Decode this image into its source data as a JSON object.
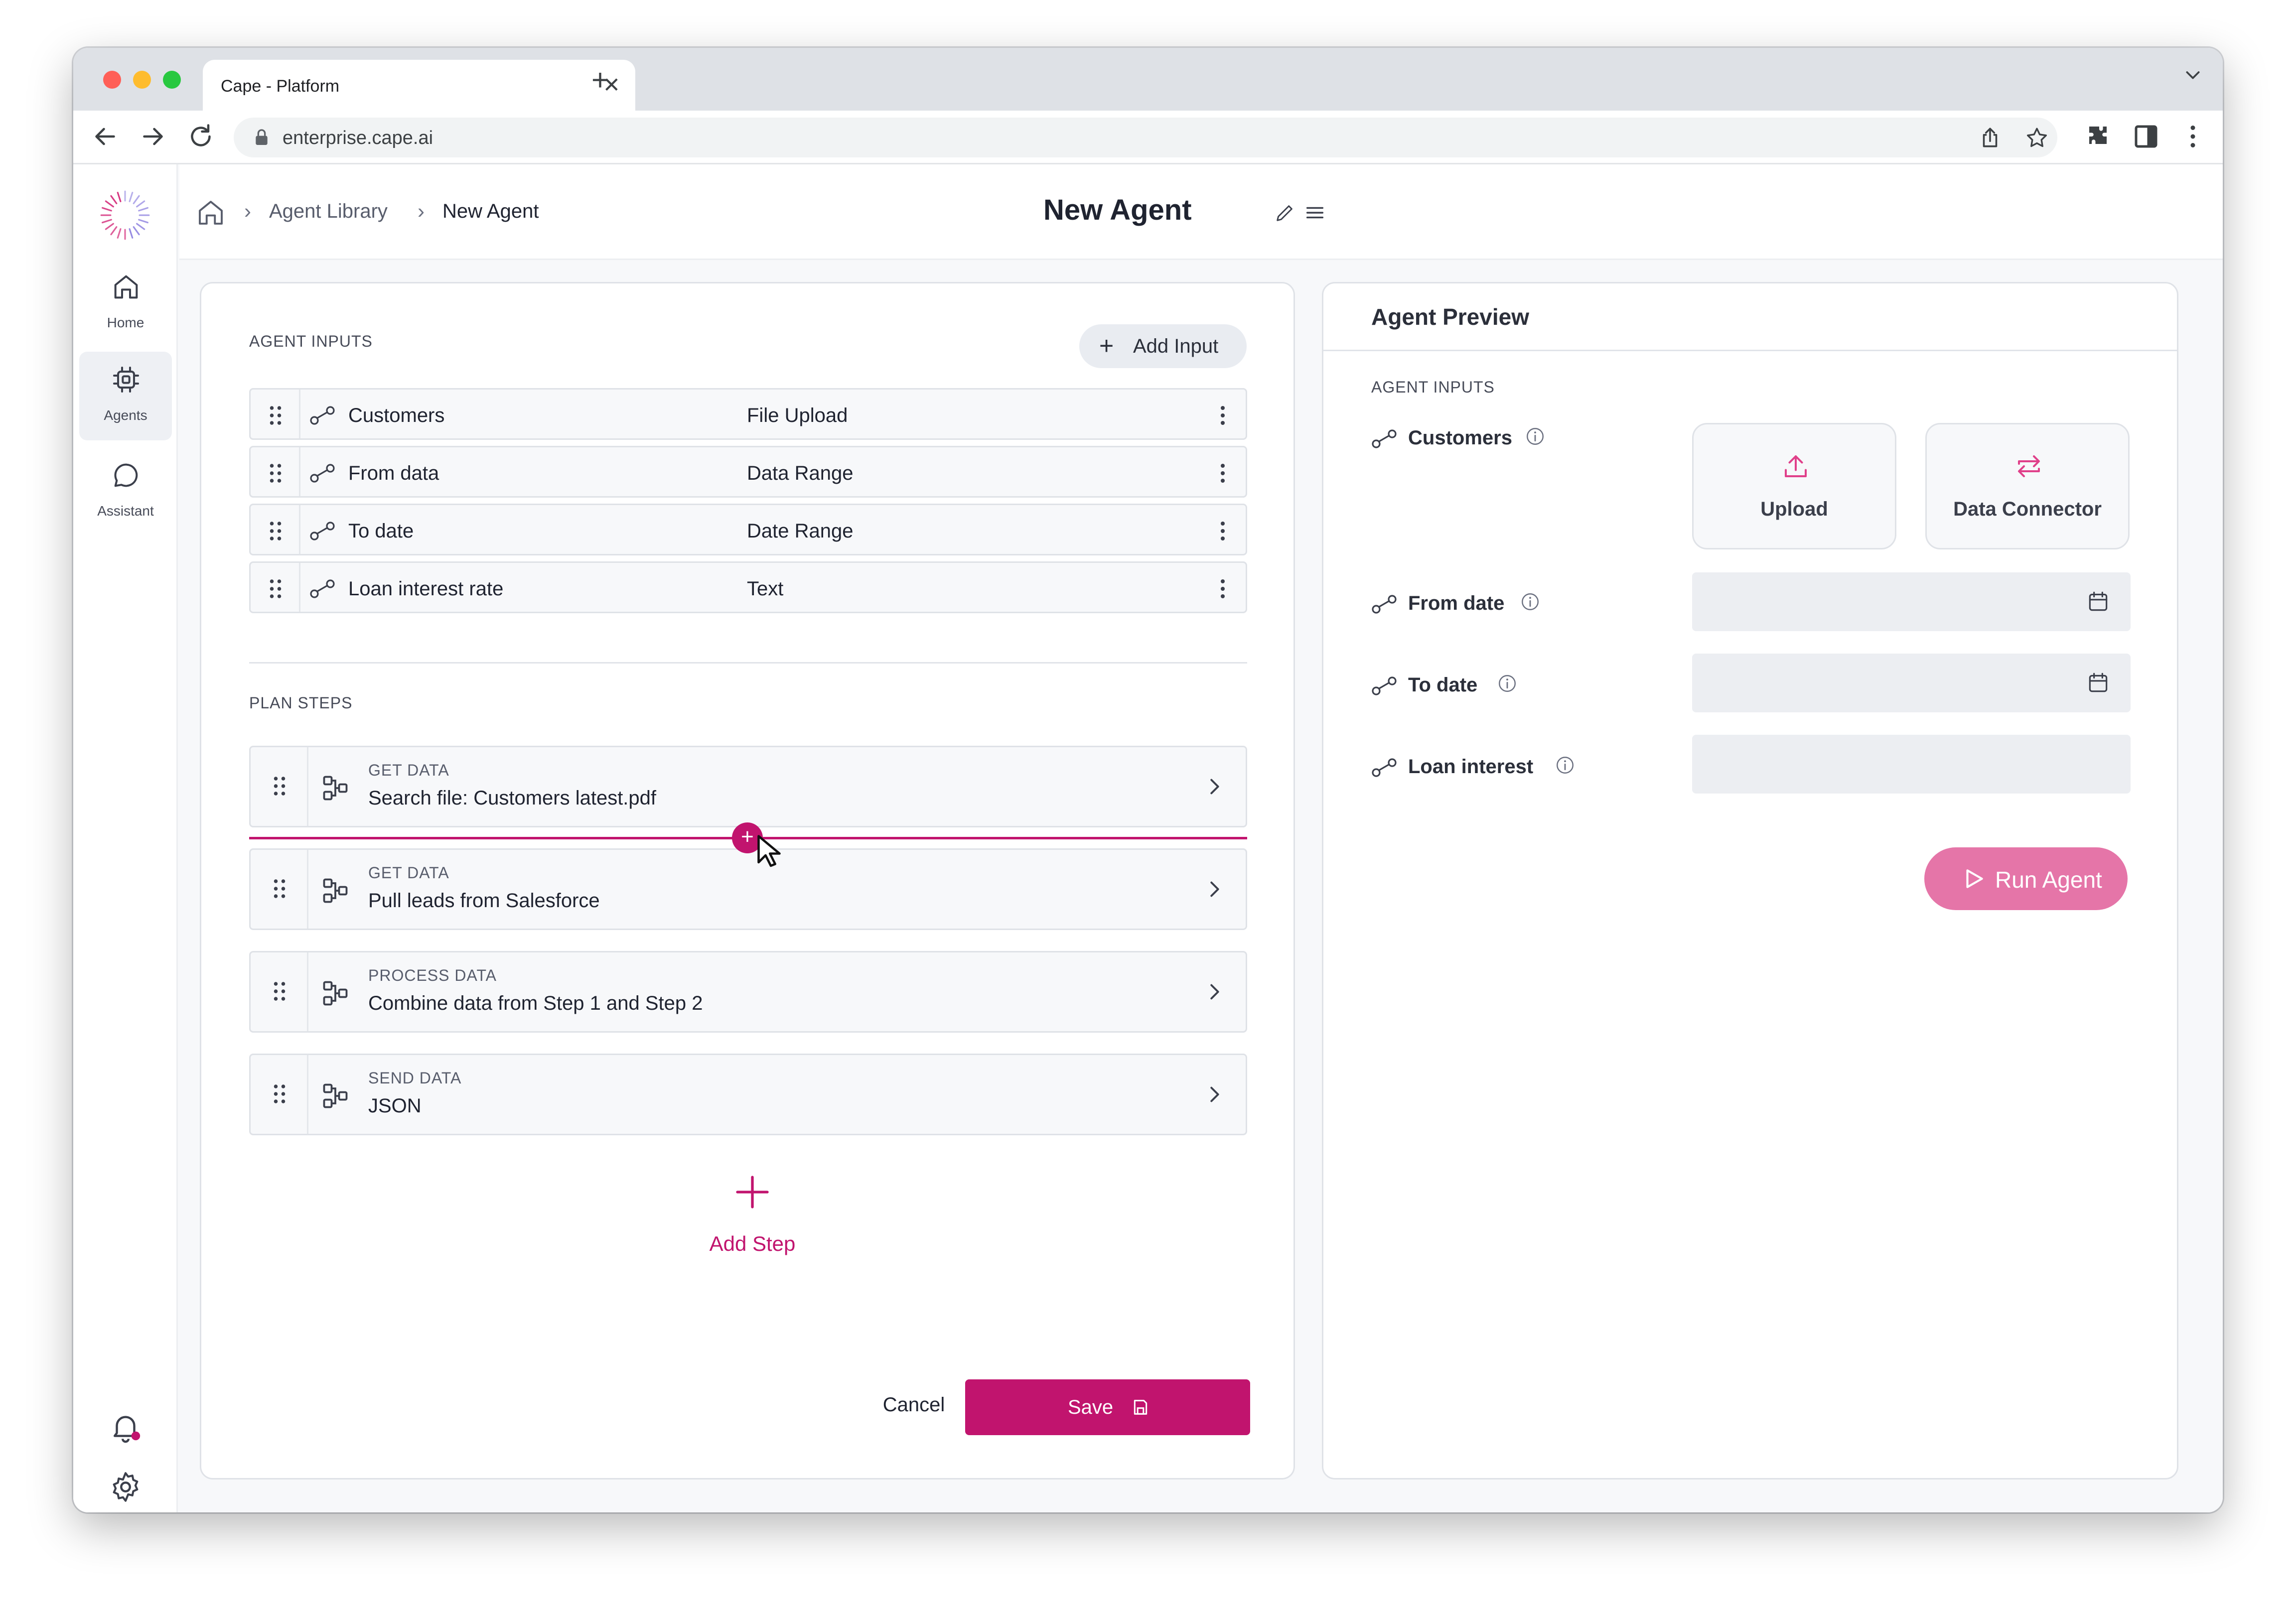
{
  "browser": {
    "tab_title": "Cape - Platform",
    "url": "enterprise.cape.ai"
  },
  "sidebar": {
    "items": [
      {
        "label": "Home",
        "icon": "home-icon"
      },
      {
        "label": "Agents",
        "icon": "agent-chip-icon",
        "active": true
      },
      {
        "label": "Assistant",
        "icon": "chat-bubble-icon"
      }
    ],
    "bottom_icons": [
      "bell-icon",
      "gear-icon"
    ]
  },
  "breadcrumb": {
    "items": [
      "Agent Library",
      "New Agent"
    ]
  },
  "page": {
    "title": "New Agent"
  },
  "editor": {
    "inputs_label": "AGENT INPUTS",
    "add_input_label": "Add Input",
    "inputs": [
      {
        "name": "Customers",
        "type": "File Upload"
      },
      {
        "name": "From data",
        "type": "Data Range"
      },
      {
        "name": "To date",
        "type": "Date Range"
      },
      {
        "name": "Loan interest rate",
        "type": "Text"
      }
    ],
    "steps_label": "PLAN STEPS",
    "steps": [
      {
        "kind": "GET DATA",
        "desc": "Search file: Customers latest.pdf"
      },
      {
        "kind": "GET DATA",
        "desc": "Pull leads from Salesforce"
      },
      {
        "kind": "PROCESS DATA",
        "desc": "Combine data from Step 1 and Step 2"
      },
      {
        "kind": "SEND DATA",
        "desc": "JSON"
      }
    ],
    "insert_symbol": "+",
    "add_step_label": "Add Step",
    "cancel_label": "Cancel",
    "save_label": "Save"
  },
  "preview": {
    "title": "Agent Preview",
    "inputs_label": "AGENT INPUTS",
    "fields": [
      {
        "label": "Customers"
      },
      {
        "label": "From date"
      },
      {
        "label": "To date"
      },
      {
        "label": "Loan interest"
      }
    ],
    "upload_label": "Upload",
    "connector_label": "Data Connector",
    "run_label": "Run Agent"
  },
  "colors": {
    "accent": "#c1146e",
    "accent_light": "#e575a8",
    "text": "#1f2330"
  }
}
